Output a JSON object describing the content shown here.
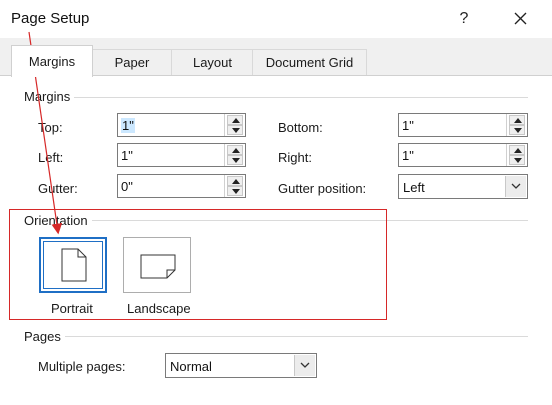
{
  "window": {
    "title": "Page Setup",
    "help_label": "?"
  },
  "tabs": [
    {
      "label": "Margins",
      "active": true
    },
    {
      "label": "Paper",
      "active": false
    },
    {
      "label": "Layout",
      "active": false
    },
    {
      "label": "Document Grid",
      "active": false
    }
  ],
  "margins": {
    "group_label": "Margins",
    "top": {
      "label": "Top:",
      "value": "1\""
    },
    "left": {
      "label": "Left:",
      "value": "1\""
    },
    "gutter": {
      "label": "Gutter:",
      "value": "0\""
    },
    "bottom": {
      "label": "Bottom:",
      "value": "1\""
    },
    "right": {
      "label": "Right:",
      "value": "1\""
    },
    "gutter_position": {
      "label": "Gutter position:",
      "value": "Left"
    }
  },
  "orientation": {
    "group_label": "Orientation",
    "portrait_label": "Portrait",
    "landscape_label": "Landscape",
    "selected": "Portrait"
  },
  "pages": {
    "group_label": "Pages",
    "multiple_pages_label": "Multiple pages:",
    "multiple_pages_value": "Normal"
  },
  "annotation": {
    "color": "#d62828"
  },
  "colors": {
    "accent": "#1f6fc5",
    "selection": "#cce8ff"
  }
}
